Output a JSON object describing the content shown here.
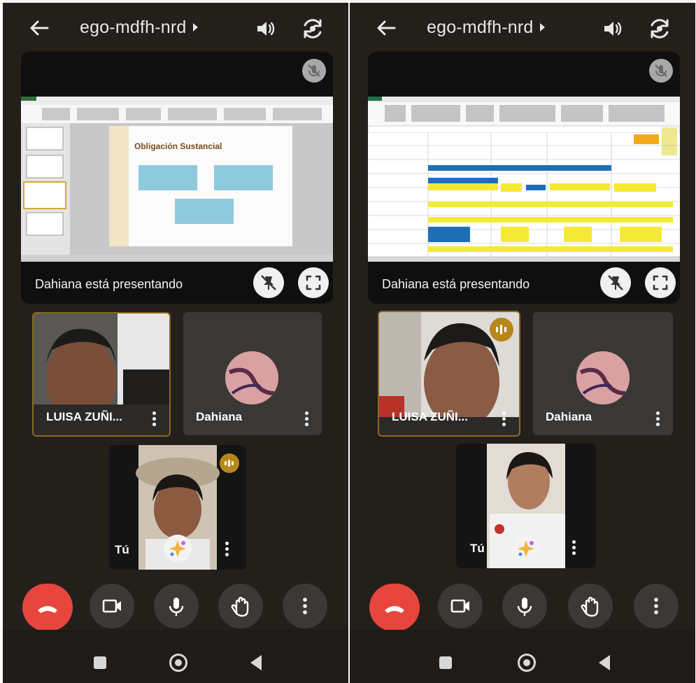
{
  "meeting": {
    "code": "ego-mdfh-nrd"
  },
  "presentation": {
    "presenter_label": "Dahiana está presentando",
    "slide_title": "Obligación Sustancial"
  },
  "participants": {
    "luisa": "LUISA ZUÑI...",
    "dahiana": "Dahiana",
    "self": "Tú"
  },
  "icons": {
    "back": "arrow-left-icon",
    "audio": "speaker-icon",
    "switch_camera": "switch-camera-icon",
    "muted": "mic-off-icon",
    "unpin": "pin-off-icon",
    "fullscreen": "fullscreen-icon",
    "more": "more-vert-icon",
    "speaking": "audio-level-icon",
    "effects": "sparkle-icon",
    "end_call": "call-end-icon",
    "camera": "videocam-icon",
    "microphone": "mic-icon",
    "raise_hand": "hand-icon",
    "nav_recents": "square-icon",
    "nav_home": "circle-icon",
    "nav_back": "triangle-back-icon"
  },
  "colors": {
    "background": "#231f1b",
    "end_call": "#e8453c",
    "active_border": "#8b6a1e",
    "speaking_badge": "#b8871a"
  }
}
